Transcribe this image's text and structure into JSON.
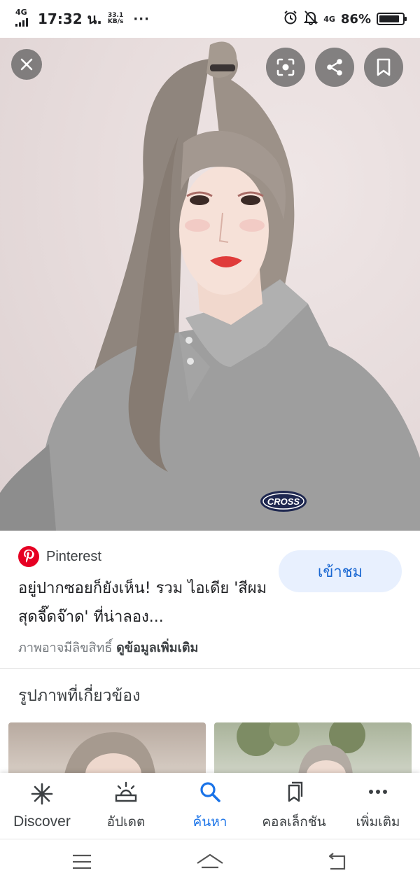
{
  "status_bar": {
    "network_left": "4G",
    "time": "17:32 น.",
    "speed_value": "33.1",
    "speed_unit": "KB/s",
    "more": "···",
    "network_right": "4G",
    "battery": "86%",
    "battery_level": 0.86
  },
  "viewer": {
    "close_icon": "close-icon",
    "lens_icon": "lens-icon",
    "share_icon": "share-icon",
    "save_icon": "bookmark-icon",
    "patch_text": "CROSS"
  },
  "info": {
    "source": "Pinterest",
    "visit_label": "เข้าชม",
    "title": "อยู่ปากซอยก็ยังเห็น! รวม ไอเดีย 'สีผมสุดจี๊ดจ๊าด' ที่น่าลอง...",
    "copyright": "ภาพอาจมีลิขสิทธิ์",
    "more_info": "ดูข้อมูลเพิ่มเติม"
  },
  "related": {
    "heading": "รูปภาพที่เกี่ยวข้อง"
  },
  "bottom_nav": {
    "items": [
      {
        "label": "Discover",
        "icon": "asterisk-icon"
      },
      {
        "label": "อัปเดต",
        "icon": "updates-icon"
      },
      {
        "label": "ค้นหา",
        "icon": "search-icon"
      },
      {
        "label": "คอลเล็กชัน",
        "icon": "collections-icon"
      },
      {
        "label": "เพิ่มเติม",
        "icon": "more-dots-icon"
      }
    ],
    "active_index": 2
  },
  "colors": {
    "accent": "#1a73e8",
    "visit_button_bg": "#e8f0fe",
    "pinterest_red": "#e60023"
  }
}
